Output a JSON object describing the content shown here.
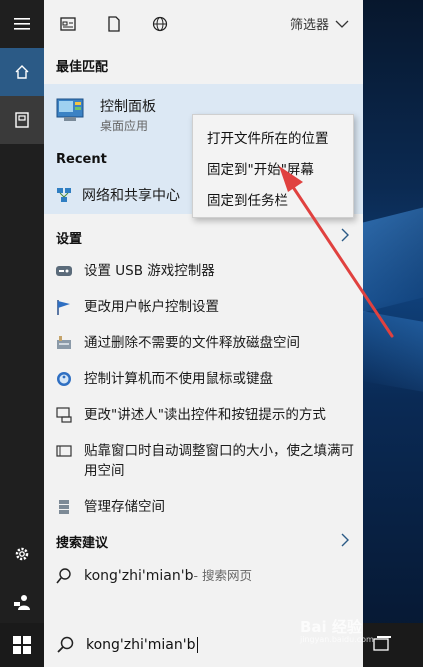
{
  "topbar": {
    "filter_label": "筛选器",
    "icons": [
      "document-view-icon",
      "file-icon",
      "globe-icon",
      "chevron-down-icon"
    ]
  },
  "best_match": {
    "heading": "最佳匹配",
    "title": "控制面板",
    "subtitle": "桌面应用"
  },
  "recent": {
    "heading": "Recent",
    "items": [
      {
        "label": "网络和共享中心"
      }
    ]
  },
  "context_menu": {
    "items": [
      {
        "label": "打开文件所在的位置"
      },
      {
        "label": "固定到\"开始\"屏幕"
      },
      {
        "label": "固定到任务栏"
      }
    ]
  },
  "settings": {
    "heading": "设置",
    "items": [
      {
        "label": "设置 USB 游戏控制器",
        "icon": "gamepad-icon"
      },
      {
        "label": "更改用户帐户控制设置",
        "icon": "flag-icon"
      },
      {
        "label": "通过删除不需要的文件释放磁盘空间",
        "icon": "disk-cleanup-icon"
      },
      {
        "label": "控制计算机而不使用鼠标或键盘",
        "icon": "ease-of-access-icon"
      },
      {
        "label": "更改\"讲述人\"读出控件和按钮提示的方式",
        "icon": "narrator-icon"
      },
      {
        "label": "贴靠窗口时自动调整窗口的大小，使之填满可用空间",
        "icon": "snap-window-icon"
      },
      {
        "label": "管理存储空间",
        "icon": "storage-icon"
      }
    ]
  },
  "suggestions": {
    "heading": "搜索建议",
    "items": [
      {
        "query": "kong'zhi'mian'b",
        "suffix": " - 搜索网页"
      }
    ]
  },
  "search": {
    "value": "kong'zhi'mian'b"
  },
  "watermark": {
    "text": "Bai 经验",
    "sub": "jingyan.baidu.com"
  },
  "colors": {
    "accent": "#2b5a86",
    "arrow": "#e0413f",
    "highlight": "#dce8f4"
  }
}
